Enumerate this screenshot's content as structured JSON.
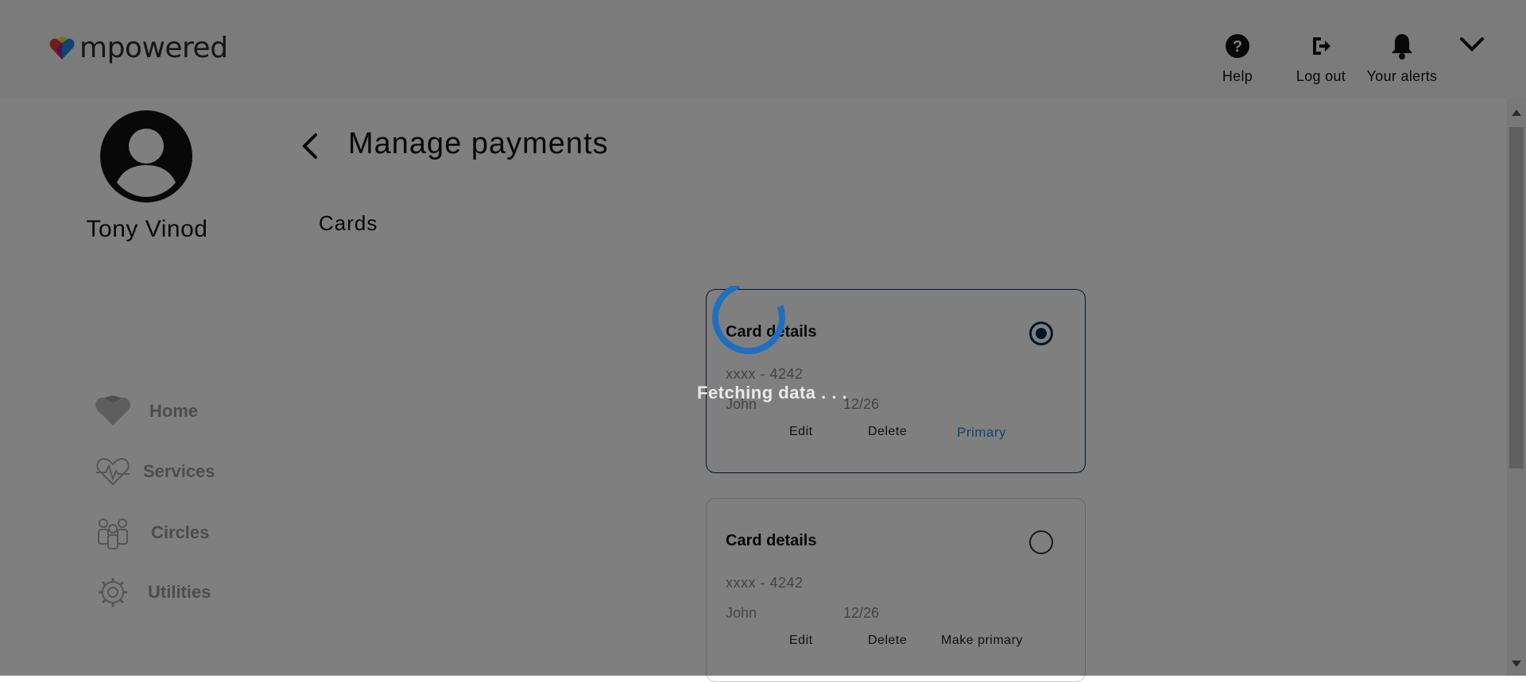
{
  "header": {
    "logo_text": "mpowered",
    "help_label": "Help",
    "logout_label": "Log out",
    "alerts_label": "Your alerts"
  },
  "profile": {
    "name": "Tony Vinod"
  },
  "nav": {
    "items": [
      {
        "label": "Home",
        "icon": "home-heart-icon"
      },
      {
        "label": "Services",
        "icon": "heartbeat-icon"
      },
      {
        "label": "Circles",
        "icon": "people-icon"
      },
      {
        "label": "Utilities",
        "icon": "gear-icon"
      }
    ]
  },
  "page": {
    "title": "Manage payments",
    "section": "Cards"
  },
  "cards": [
    {
      "title": "Card details",
      "number": "xxxx - 4242",
      "holder": "John",
      "expiry": "12/26",
      "edit": "Edit",
      "delete": "Delete",
      "status": "Primary",
      "selected": true
    },
    {
      "title": "Card details",
      "number": "xxxx - 4242",
      "holder": "John",
      "expiry": "12/26",
      "edit": "Edit",
      "delete": "Delete",
      "status": "Make primary",
      "selected": false
    }
  ],
  "loading": {
    "text": "Fetching data . . ."
  },
  "colors": {
    "accent": "#1e88e5",
    "primary_border": "#0b2a4a",
    "overlay": "rgba(0,0,0,0.5)"
  }
}
